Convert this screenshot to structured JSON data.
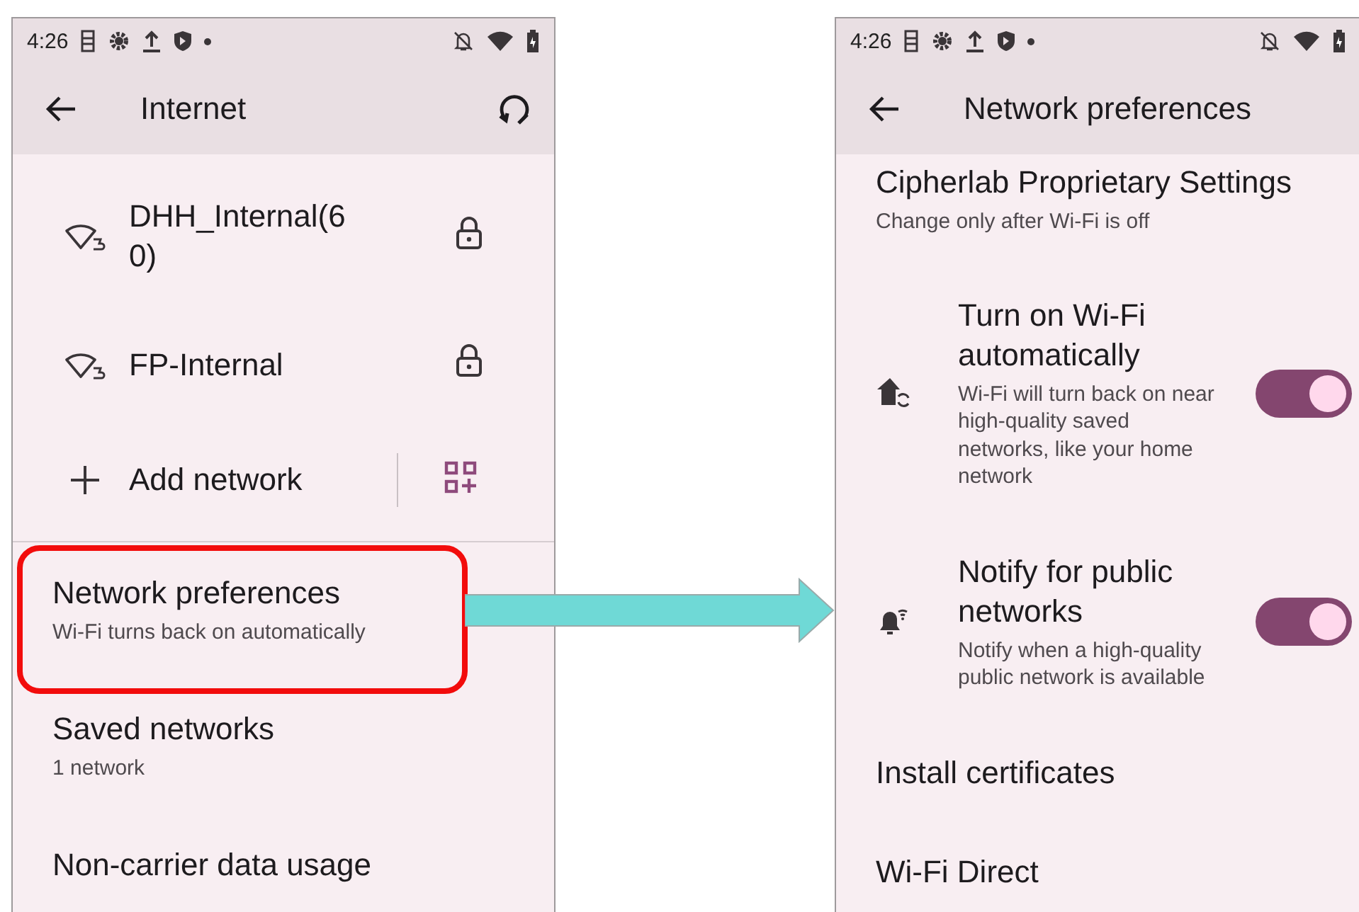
{
  "screens": [
    {
      "status_bar": {
        "time": "4:26"
      },
      "toolbar": {
        "title": "Internet"
      },
      "items": [
        {
          "kind": "network",
          "name": "DHH_Internal(6\n0)",
          "locked": true
        },
        {
          "kind": "network",
          "name": "FP-Internal",
          "locked": true
        },
        {
          "kind": "add",
          "title": "Add network"
        },
        {
          "kind": "pref",
          "title": "Network preferences",
          "subtitle": "Wi-Fi turns back on automatically"
        },
        {
          "kind": "pref",
          "title": "Saved networks",
          "subtitle": "1 network"
        },
        {
          "kind": "pref",
          "title": "Non-carrier data usage"
        }
      ]
    },
    {
      "status_bar": {
        "time": "4:26"
      },
      "toolbar": {
        "title": "Network preferences"
      },
      "items": [
        {
          "kind": "header",
          "title": "Cipherlab Proprietary Settings",
          "subtitle": "Change only after Wi-Fi is off"
        },
        {
          "kind": "toggle",
          "title": "Turn on Wi-Fi automatically",
          "subtitle": "Wi-Fi will turn back on near high-quality saved networks, like your home network",
          "on": true
        },
        {
          "kind": "toggle",
          "title": "Notify for public networks",
          "subtitle": "Notify when a high-quality public network is available",
          "on": true
        },
        {
          "kind": "plain",
          "title": "Install certificates"
        },
        {
          "kind": "plain",
          "title": "Wi-Fi Direct"
        }
      ]
    }
  ]
}
